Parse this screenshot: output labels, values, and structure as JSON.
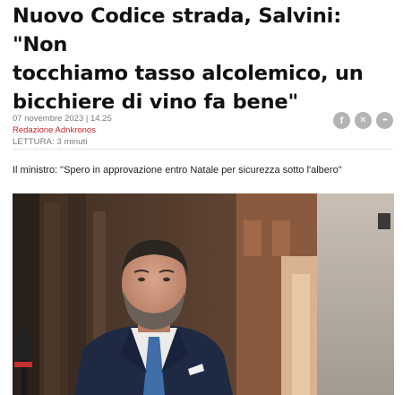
{
  "article": {
    "headline_line1": "Nuovo Codice strada, Salvini: \"Non",
    "headline_line2": "tocchiamo tasso alcolemico, un",
    "headline_line3": "bicchiere di vino fa bene\"",
    "date": "07 novembre 2023 | 14.25",
    "author": "Redazione Adnkronos",
    "reading_time": "LETTURA: 3 minuti",
    "subtitle": "Il ministro: \"Spero in approvazione entro Natale per sicurezza sotto l'albero\""
  },
  "share": {
    "facebook_icon": "f",
    "x_icon": "✕",
    "more_icon": "•••"
  },
  "colors": {
    "author_red": "#c0262d",
    "share_grey": "#b4b4b4",
    "meta_grey": "#7a7a7a"
  },
  "photo": {
    "icons": [
      "person-photo",
      "microphone-icon"
    ]
  }
}
